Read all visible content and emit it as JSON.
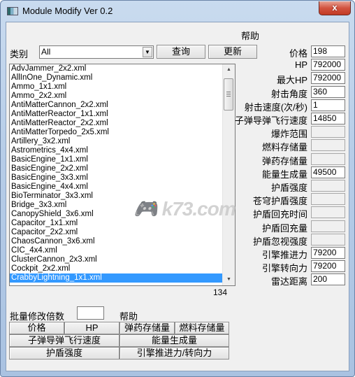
{
  "window": {
    "title": "Module Modify Ver 0.2",
    "close_label": "x"
  },
  "help_top": "帮助",
  "filter": {
    "label": "类别",
    "value": "All",
    "query_button": "查询",
    "update_button": "更新"
  },
  "list": {
    "items": [
      "AdvJammer_2x2.xml",
      "AllInOne_Dynamic.xml",
      "Ammo_1x1.xml",
      "Ammo_2x2.xml",
      "AntiMatterCannon_2x2.xml",
      "AntiMatterReactor_1x1.xml",
      "AntiMatterReactor_2x2.xml",
      "AntiMatterTorpedo_2x5.xml",
      "Artillery_3x2.xml",
      "Astrometrics_4x4.xml",
      "BasicEngine_1x1.xml",
      "BasicEngine_2x2.xml",
      "BasicEngine_3x3.xml",
      "BasicEngine_4x4.xml",
      "BioTerminator_3x3.xml",
      "Bridge_3x3.xml",
      "CanopyShield_3x6.xml",
      "Capacitor_1x1.xml",
      "Capacitor_2x2.xml",
      "ChaosCannon_3x6.xml",
      "CIC_4x4.xml",
      "ClusterCannon_2x3.xml",
      "Cockpit_2x2.xml",
      "CrabbyLightning_1x1.xml"
    ],
    "selected_index": 23,
    "count": "134"
  },
  "watermark": "k73.com",
  "properties": [
    {
      "label": "价格",
      "value": "198",
      "enabled": true
    },
    {
      "label": "HP",
      "value": "792000",
      "enabled": true
    },
    {
      "label": "最大HP",
      "value": "792000",
      "enabled": true
    },
    {
      "label": "射击角度",
      "value": "360",
      "enabled": true
    },
    {
      "label": "射击速度(次/秒)",
      "value": "1",
      "enabled": true
    },
    {
      "label": "子弹导弹飞行速度",
      "value": "14850",
      "enabled": true
    },
    {
      "label": "爆炸范围",
      "value": "",
      "enabled": false
    },
    {
      "label": "燃料存储量",
      "value": "",
      "enabled": false
    },
    {
      "label": "弹药存储量",
      "value": "",
      "enabled": false
    },
    {
      "label": "能量生成量",
      "value": "49500",
      "enabled": true
    },
    {
      "label": "护盾强度",
      "value": "",
      "enabled": false
    },
    {
      "label": "苍穹护盾强度",
      "value": "",
      "enabled": false
    },
    {
      "label": "护盾回充时间",
      "value": "",
      "enabled": false
    },
    {
      "label": "护盾回充量",
      "value": "",
      "enabled": false
    },
    {
      "label": "护盾忽视强度",
      "value": "",
      "enabled": false
    },
    {
      "label": "引擎推进力",
      "value": "79200",
      "enabled": true
    },
    {
      "label": "引擎转向力",
      "value": "79200",
      "enabled": true
    },
    {
      "label": "雷达距离",
      "value": "200",
      "enabled": true
    }
  ],
  "batch": {
    "label": "批量修改倍数",
    "value": "",
    "help": "帮助",
    "buttons": {
      "price": "价格",
      "hp": "HP",
      "ammo_storage": "弹药存储量",
      "fuel_storage": "燃料存储量",
      "projectile_speed": "子弹导弹飞行速度",
      "energy_gen": "能量生成量",
      "shield_strength": "护盾强度",
      "engine_thrust_turn": "引擎推进力/转向力"
    }
  }
}
